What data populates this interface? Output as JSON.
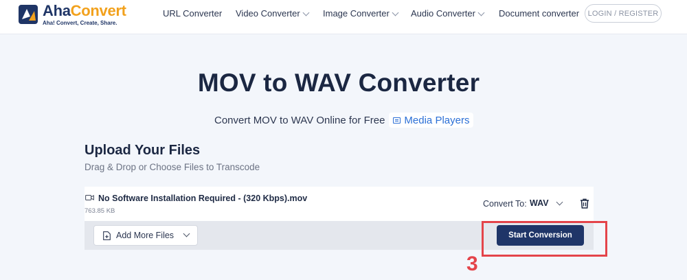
{
  "header": {
    "logo": {
      "name_part1": "Aha",
      "name_part2": "Convert",
      "tagline": "Aha! Convert, Create, Share."
    },
    "nav": [
      {
        "label": "URL Converter",
        "has_dropdown": false
      },
      {
        "label": "Video Converter",
        "has_dropdown": true
      },
      {
        "label": "Image Converter",
        "has_dropdown": true
      },
      {
        "label": "Audio Converter",
        "has_dropdown": true
      },
      {
        "label": "Document converter",
        "has_dropdown": false
      }
    ],
    "login_label": "LOGIN / REGISTER"
  },
  "hero": {
    "title": "MOV to WAV Converter",
    "subtitle": "Convert MOV to WAV Online for Free",
    "chip_label": "Media Players"
  },
  "upload": {
    "title": "Upload Your Files",
    "subtitle": "Drag & Drop or Choose Files to Transcode",
    "file": {
      "name": "No Software Installation Required - (320 Kbps).mov",
      "size": "763.85 KB",
      "convert_to_label": "Convert To:",
      "format": "WAV"
    },
    "add_more_label": "Add More Files",
    "start_label": "Start Conversion"
  },
  "annotation": {
    "step": "3",
    "color": "#e4444a"
  },
  "colors": {
    "brand_dark": "#1f3566",
    "brand_orange": "#f2a11c",
    "link_blue": "#2b6fd6",
    "button_navy": "#1f3568"
  }
}
